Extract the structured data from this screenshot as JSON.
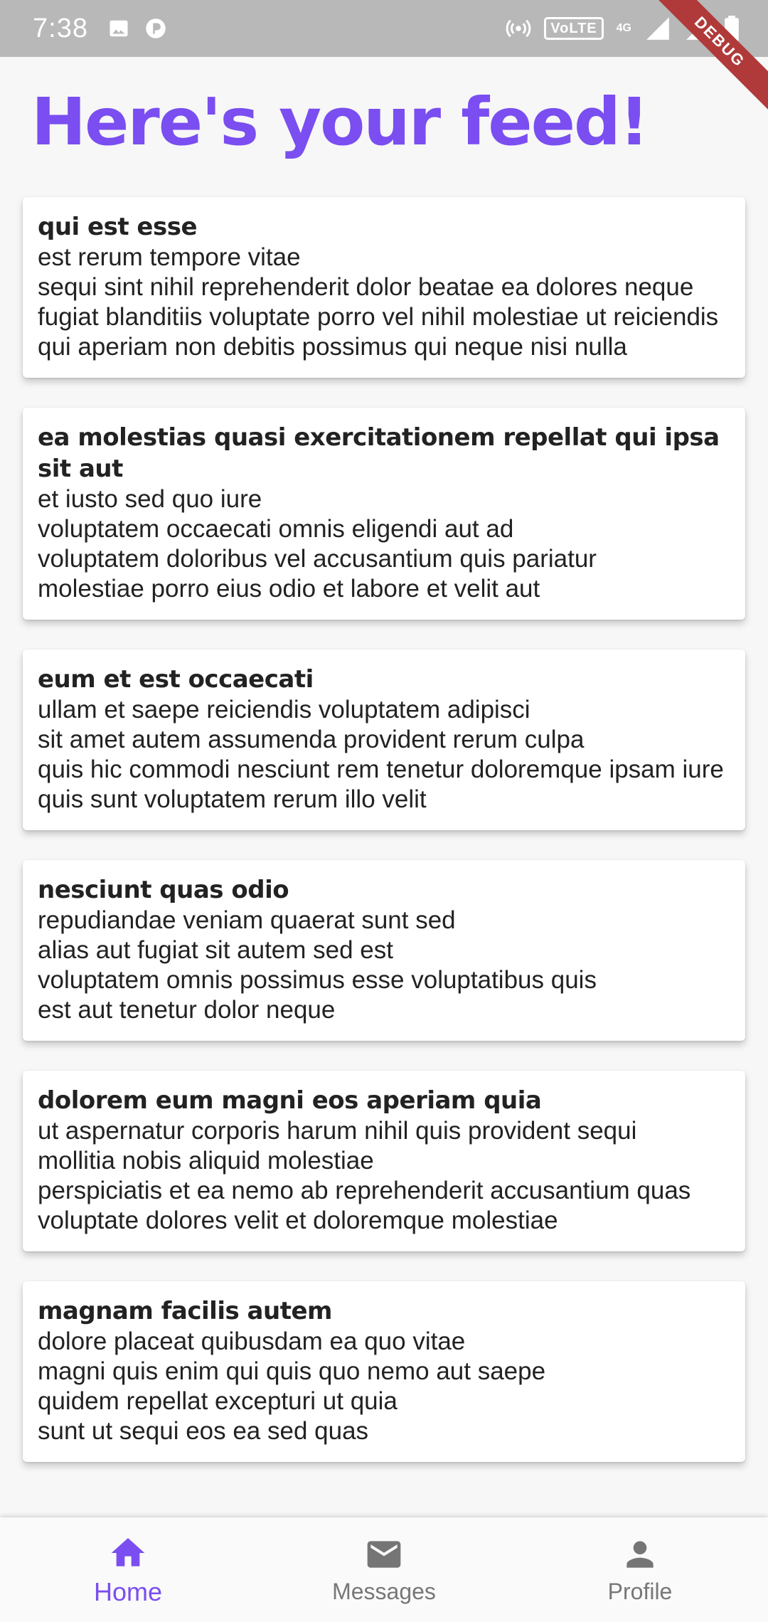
{
  "status_bar": {
    "time": "7:38",
    "left_icons": [
      "image-icon",
      "parking-app-icon"
    ],
    "right_icons": [
      "hotspot-icon",
      "volte-badge",
      "network-icon",
      "signal-icon",
      "signal-icon",
      "battery-icon"
    ],
    "volte_label": "VoLTE",
    "network_label": "4G"
  },
  "debug_banner": "DEBUG",
  "page": {
    "title": "Here's your feed!"
  },
  "colors": {
    "accent": "#7a4ef0",
    "status_bar": "#b8b8b8",
    "background": "#f7f7f7",
    "debug": "#b03a3a"
  },
  "feed": [
    {
      "title": "qui est esse",
      "body": "est rerum tempore vitae\nsequi sint nihil reprehenderit dolor beatae ea dolores neque\nfugiat blanditiis voluptate porro vel nihil molestiae ut reiciendis\nqui aperiam non debitis possimus qui neque nisi nulla"
    },
    {
      "title": "ea molestias quasi exercitationem repellat qui ipsa sit aut",
      "body": "et iusto sed quo iure\nvoluptatem occaecati omnis eligendi aut ad\nvoluptatem doloribus vel accusantium quis pariatur\nmolestiae porro eius odio et labore et velit aut"
    },
    {
      "title": "eum et est occaecati",
      "body": "ullam et saepe reiciendis voluptatem adipisci\nsit amet autem assumenda provident rerum culpa\nquis hic commodi nesciunt rem tenetur doloremque ipsam iure\nquis sunt voluptatem rerum illo velit"
    },
    {
      "title": "nesciunt quas odio",
      "body": "repudiandae veniam quaerat sunt sed\nalias aut fugiat sit autem sed est\nvoluptatem omnis possimus esse voluptatibus quis\nest aut tenetur dolor neque"
    },
    {
      "title": "dolorem eum magni eos aperiam quia",
      "body": "ut aspernatur corporis harum nihil quis provident sequi\nmollitia nobis aliquid molestiae\nperspiciatis et ea nemo ab reprehenderit accusantium quas\nvoluptate dolores velit et doloremque molestiae"
    },
    {
      "title": "magnam facilis autem",
      "body": "dolore placeat quibusdam ea quo vitae\nmagni quis enim qui quis quo nemo aut saepe\nquidem repellat excepturi ut quia\nsunt ut sequi eos ea sed quas"
    }
  ],
  "bottom_nav": {
    "items": [
      {
        "label": "Home",
        "icon": "home-icon",
        "active": true
      },
      {
        "label": "Messages",
        "icon": "mail-icon",
        "active": false
      },
      {
        "label": "Profile",
        "icon": "person-icon",
        "active": false
      }
    ]
  }
}
